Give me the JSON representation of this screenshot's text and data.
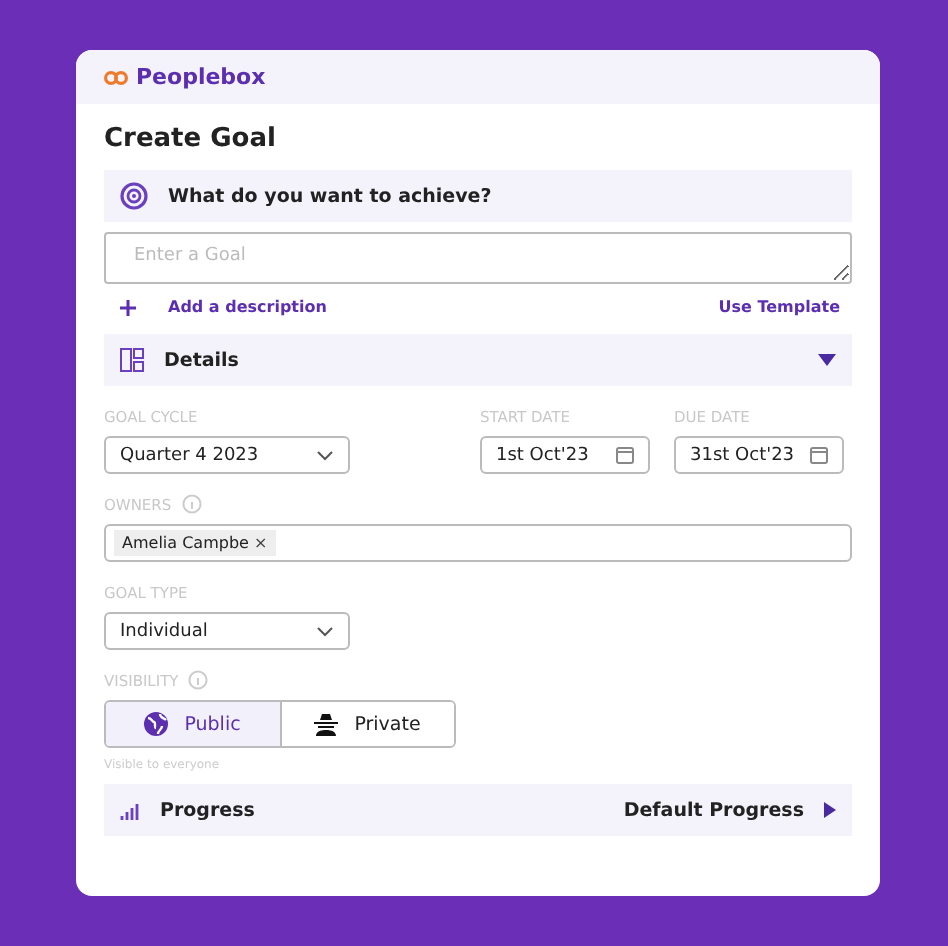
{
  "brand": "Peoplebox",
  "title": "Create Goal",
  "achieve": {
    "heading": "What do you want to achieve?",
    "placeholder": "Enter a Goal",
    "add_description": "Add a description",
    "use_template": "Use Template"
  },
  "details": {
    "heading": "Details",
    "expanded": true
  },
  "goal_cycle": {
    "label": "GOAL CYCLE",
    "value": "Quarter 4 2023"
  },
  "start_date": {
    "label": "START DATE",
    "value": "1st Oct'23"
  },
  "due_date": {
    "label": "DUE DATE",
    "value": "31st Oct'23"
  },
  "owners": {
    "label": "OWNERS",
    "tags": [
      {
        "name": "Amelia Campbe",
        "remove": "×"
      }
    ]
  },
  "goal_type": {
    "label": "GOAL TYPE",
    "value": "Individual"
  },
  "visibility": {
    "label": "VISIBILITY",
    "options": [
      {
        "kind": "public",
        "label": "Public",
        "selected": true
      },
      {
        "kind": "private",
        "label": "Private",
        "selected": false
      }
    ],
    "hint": "Visible to everyone"
  },
  "progress": {
    "heading": "Progress",
    "value": "Default Progress"
  }
}
